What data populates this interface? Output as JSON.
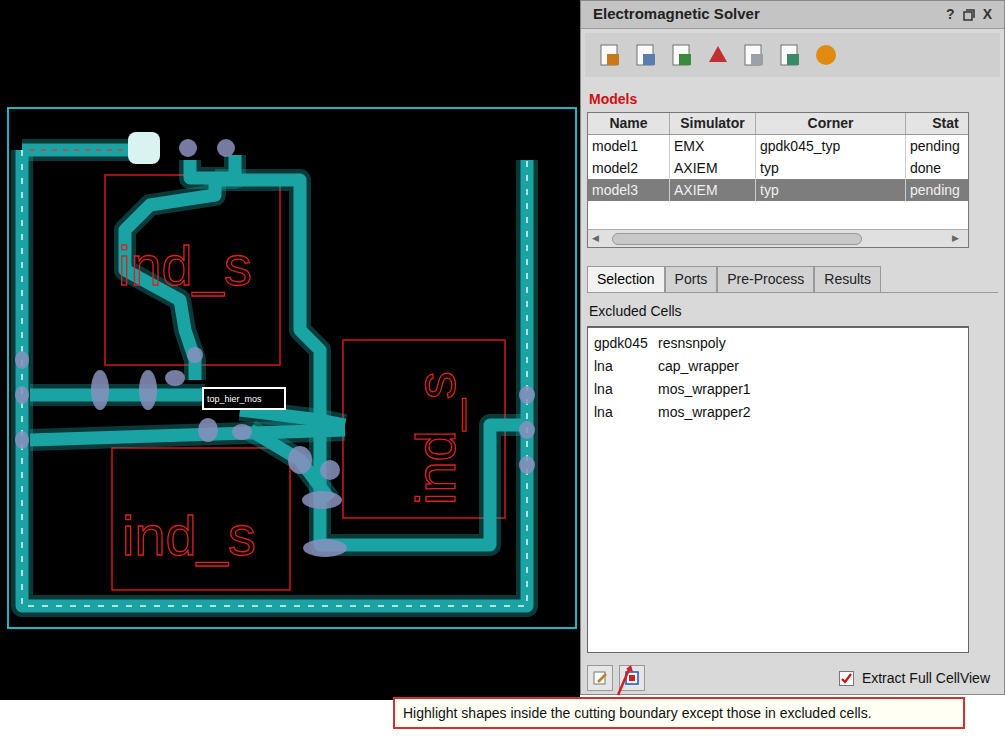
{
  "layout": {
    "labels": [
      {
        "text": "ind_s",
        "rotated": false
      },
      {
        "text": "ind_s",
        "rotated": true
      },
      {
        "text": "ind_s",
        "rotated": false
      }
    ],
    "instance_label": "top_hier_mos"
  },
  "panel": {
    "title": "Electromagnetic Solver",
    "title_buttons": [
      "?",
      "X"
    ],
    "models_label": "Models",
    "columns": [
      "Name",
      "Simulator",
      "Corner",
      "Stat"
    ],
    "rows": [
      {
        "name": "model1",
        "simulator": "EMX",
        "corner": "gpdk045_typ",
        "status": "pending",
        "selected": false
      },
      {
        "name": "model2",
        "simulator": "AXIEM",
        "corner": "typ",
        "status": "done",
        "selected": false
      },
      {
        "name": "model3",
        "simulator": "AXIEM",
        "corner": "typ",
        "status": "pending",
        "selected": true
      }
    ],
    "tabs": [
      {
        "label": "Selection",
        "selected": true
      },
      {
        "label": "Ports",
        "selected": false
      },
      {
        "label": "Pre-Process",
        "selected": false
      },
      {
        "label": "Results",
        "selected": false
      }
    ],
    "excluded_label": "Excluded Cells",
    "excluded": [
      {
        "library": "gpdk045",
        "cell": "resnsnpoly"
      },
      {
        "library": "lna",
        "cell": "cap_wrapper"
      },
      {
        "library": "lna",
        "cell": "mos_wrapper1"
      },
      {
        "library": "lna",
        "cell": "mos_wrapper2"
      }
    ],
    "extract_full": {
      "label": "Extract Full CellView",
      "checked": true
    }
  },
  "tooltip": "Highlight shapes inside the cutting boundary except those in excluded cells."
}
